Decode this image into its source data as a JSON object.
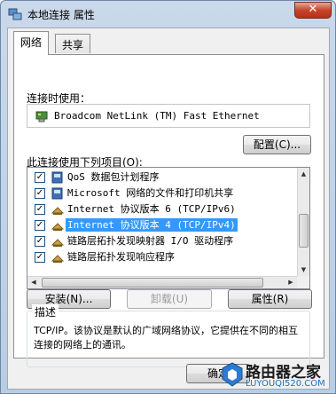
{
  "window": {
    "title": "本地连接 属性",
    "close_label": "✕"
  },
  "tabs": [
    {
      "label": "网络"
    },
    {
      "label": "共享"
    }
  ],
  "connect_using": {
    "label": "连接时使用：",
    "adapter_name": "Broadcom NetLink (TM) Fast Ethernet",
    "configure_label": "配置(C)..."
  },
  "items_label": "此连接使用下列项目(O):",
  "items": [
    {
      "label": "QoS 数据包计划程序",
      "checked": true,
      "icon": "qos-icon"
    },
    {
      "label": "Microsoft 网络的文件和打印机共享",
      "checked": true,
      "icon": "network-share-icon"
    },
    {
      "label": "Internet 协议版本 6 (TCP/IPv6)",
      "checked": true,
      "icon": "protocol-icon"
    },
    {
      "label": "Internet 协议版本 4 (TCP/IPv4)",
      "checked": true,
      "icon": "protocol-icon",
      "selected": true
    },
    {
      "label": "链路层拓扑发现映射器 I/O 驱动程序",
      "checked": true,
      "icon": "protocol-icon"
    },
    {
      "label": "链路层拓扑发现响应程序",
      "checked": true,
      "icon": "protocol-icon"
    }
  ],
  "buttons": {
    "install": "安装(N)...",
    "uninstall": "卸载(U)",
    "properties": "属性(R)"
  },
  "description": {
    "legend": "描述",
    "text": "TCP/IP。该协议是默认的广域网络协议，它提供在不同的相互连接的网络上的通讯。"
  },
  "ok_label": "确定",
  "watermark": {
    "text": "路由器之家",
    "url": "LUYOUQI520.COM"
  },
  "colors": {
    "selection": "#3399ff",
    "close_button": "#c7452c"
  }
}
